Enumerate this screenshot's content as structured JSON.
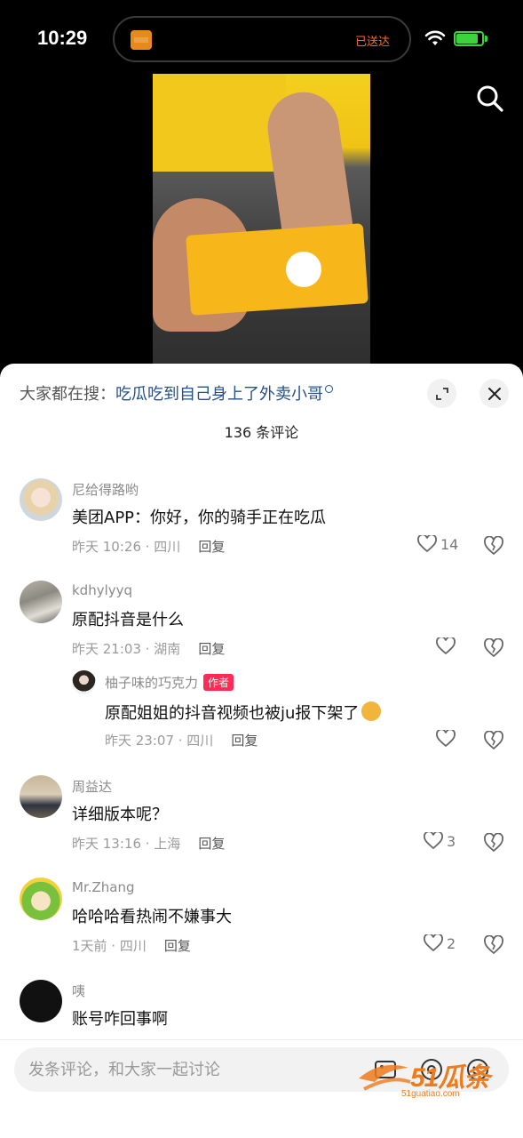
{
  "status_bar": {
    "time": "10:29",
    "island_status": "已送达",
    "battery_level": 0.85,
    "accent": "#3ed33e"
  },
  "video": {
    "search_icon": "search-icon"
  },
  "sheet": {
    "hot_search_prefix": "大家都在搜：",
    "hot_search_term": "吃瓜吃到自己身上了外卖小哥",
    "comment_count": "136 条评论"
  },
  "comments": [
    {
      "user": "尼给得路哟",
      "text": "美团APP：你好，你的骑手正在吃瓜",
      "time": "昨天 10:26 · 四川",
      "reply": "回复",
      "likes": "14"
    },
    {
      "user": "kdhylyyq",
      "text": "原配抖音是什么",
      "time": "昨天 21:03 · 湖南",
      "reply": "回复",
      "likes": ""
    },
    {
      "user": "柚子味的巧克力",
      "author_tag": "作者",
      "text": "原配姐姐的抖音视频也被ju报下架了",
      "time": "昨天 23:07 · 四川",
      "reply": "回复",
      "likes": ""
    },
    {
      "user": "周益达",
      "text": "详细版本呢？",
      "time": "昨天 13:16 · 上海",
      "reply": "回复",
      "likes": "3"
    },
    {
      "user": "Mr.Zhang",
      "text": "哈哈哈看热闹不嫌事大",
      "time": "1天前 · 四川",
      "reply": "回复",
      "likes": "2"
    },
    {
      "user": "咦",
      "text": "账号咋回事啊"
    }
  ],
  "input": {
    "placeholder": "发条评论，和大家一起讨论"
  },
  "watermark": {
    "text": "51瓜条",
    "url": "51guatiao.com"
  }
}
